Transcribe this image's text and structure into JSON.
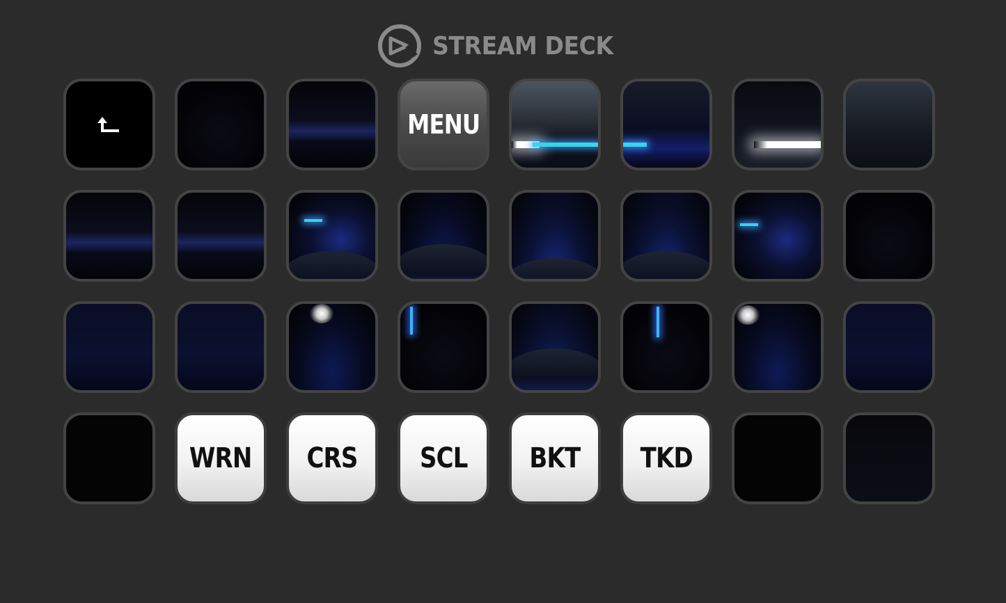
{
  "app": {
    "brand": "STREAM DECK",
    "logo_icon": "elgato-logo-icon"
  },
  "colors": {
    "background": "#2b2b2b",
    "key_border": "#444444",
    "brand_text": "#8a8a8a",
    "light_key": "#f2f2f2",
    "menu_key": "#4a4a4a"
  },
  "keys": {
    "back": {
      "icon": "back-arrow-icon"
    },
    "menu": {
      "label": "MENU"
    },
    "wrn": {
      "label": "WRN"
    },
    "crs": {
      "label": "CRS"
    },
    "scl": {
      "label": "SCL"
    },
    "bkt": {
      "label": "BKT"
    },
    "tkd": {
      "label": "TKD"
    }
  }
}
